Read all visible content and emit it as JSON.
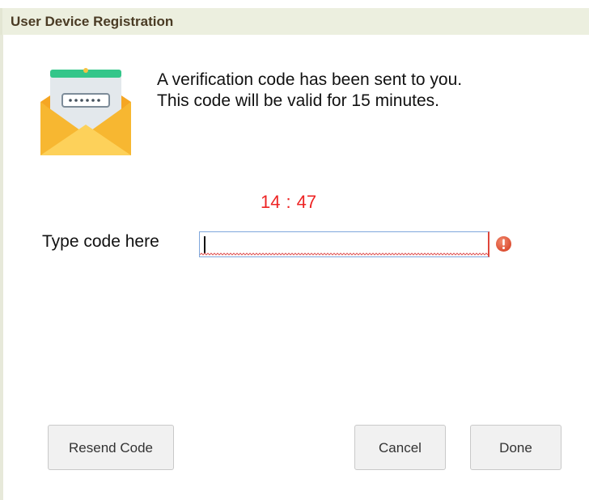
{
  "dialog": {
    "title": "User Device Registration"
  },
  "message": {
    "line1": "A verification code has been sent to you.",
    "line2": "This code will be valid for 15 minutes."
  },
  "timer": {
    "minutes": "14",
    "separator": ":",
    "seconds": "47",
    "color": "#ee2424"
  },
  "code_field": {
    "label": "Type code here",
    "value": "",
    "state": "error"
  },
  "icons": {
    "envelope": "envelope-code-icon",
    "error": "error-exclamation-icon"
  },
  "buttons": {
    "resend": "Resend Code",
    "cancel": "Cancel",
    "done": "Done"
  }
}
